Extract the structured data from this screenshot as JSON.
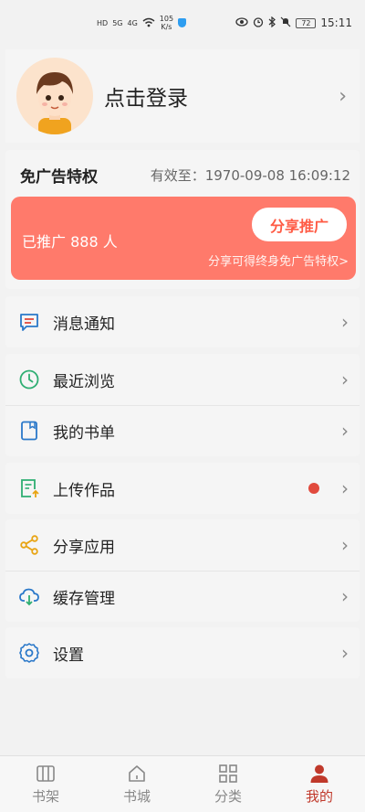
{
  "status_bar": {
    "left_items": [
      "HD",
      "HD",
      "5G",
      "4G"
    ],
    "speed_value": "105",
    "speed_unit": "K/s",
    "battery": "72",
    "time": "15:11"
  },
  "profile": {
    "login_text": "点击登录"
  },
  "vip": {
    "title": "免广告特权",
    "valid_until": "有效至：1970-09-08 16:09:12",
    "promoted": "已推广 888 人",
    "share_button": "分享推广",
    "share_hint": "分享可得终身免广告特权>"
  },
  "menu": {
    "messages": "消息通知",
    "recent": "最近浏览",
    "booklist": "我的书单",
    "upload": "上传作品",
    "share_app": "分享应用",
    "cache": "缓存管理",
    "settings": "设置"
  },
  "tabs": [
    {
      "label": "书架",
      "active": false
    },
    {
      "label": "书城",
      "active": false
    },
    {
      "label": "分类",
      "active": false
    },
    {
      "label": "我的",
      "active": true
    }
  ],
  "colors": {
    "accent": "#c0392b",
    "banner": "#ff7a6b",
    "icon_blue": "#2a78c9",
    "icon_green": "#2eae72",
    "icon_yellow": "#e8a412"
  },
  "icons": {
    "chevron": "›"
  }
}
